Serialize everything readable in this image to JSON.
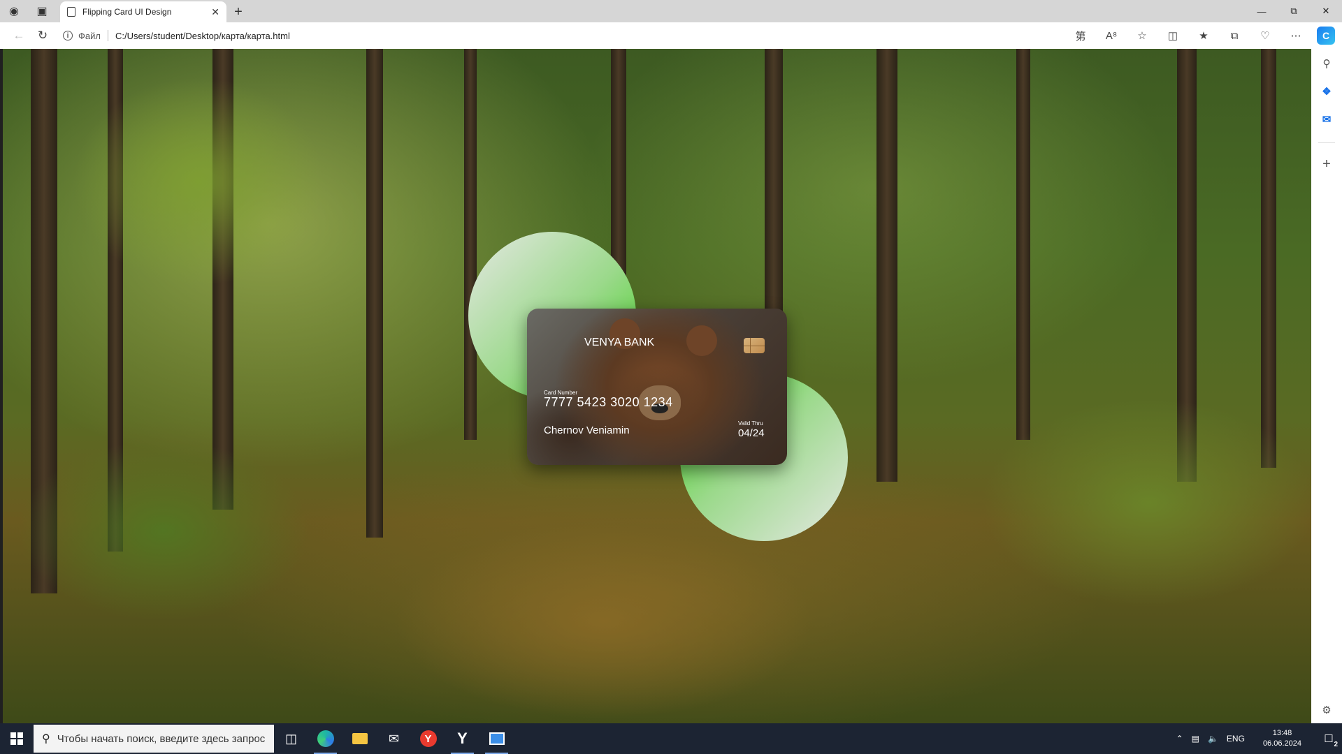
{
  "browser": {
    "tab_title": "Flipping Card UI Design",
    "url_scheme": "Файл",
    "url": "C:/Users/student/Desktop/карта/карта.html"
  },
  "card": {
    "bank_name": "VENYA BANK",
    "number_label": "Card Number",
    "number": "7777 5423 3020 1234",
    "holder": "Chernov Veniamin",
    "valid_label": "Valid Thru",
    "valid_date": "04/24"
  },
  "taskbar": {
    "search_placeholder": "Чтобы начать поиск, введите здесь запрос",
    "language": "ENG",
    "time": "13:48",
    "date": "06.06.2024",
    "notification_count": "2"
  },
  "colors": {
    "circle_green": "#4ad22a",
    "taskbar_bg": "#1c2433"
  }
}
